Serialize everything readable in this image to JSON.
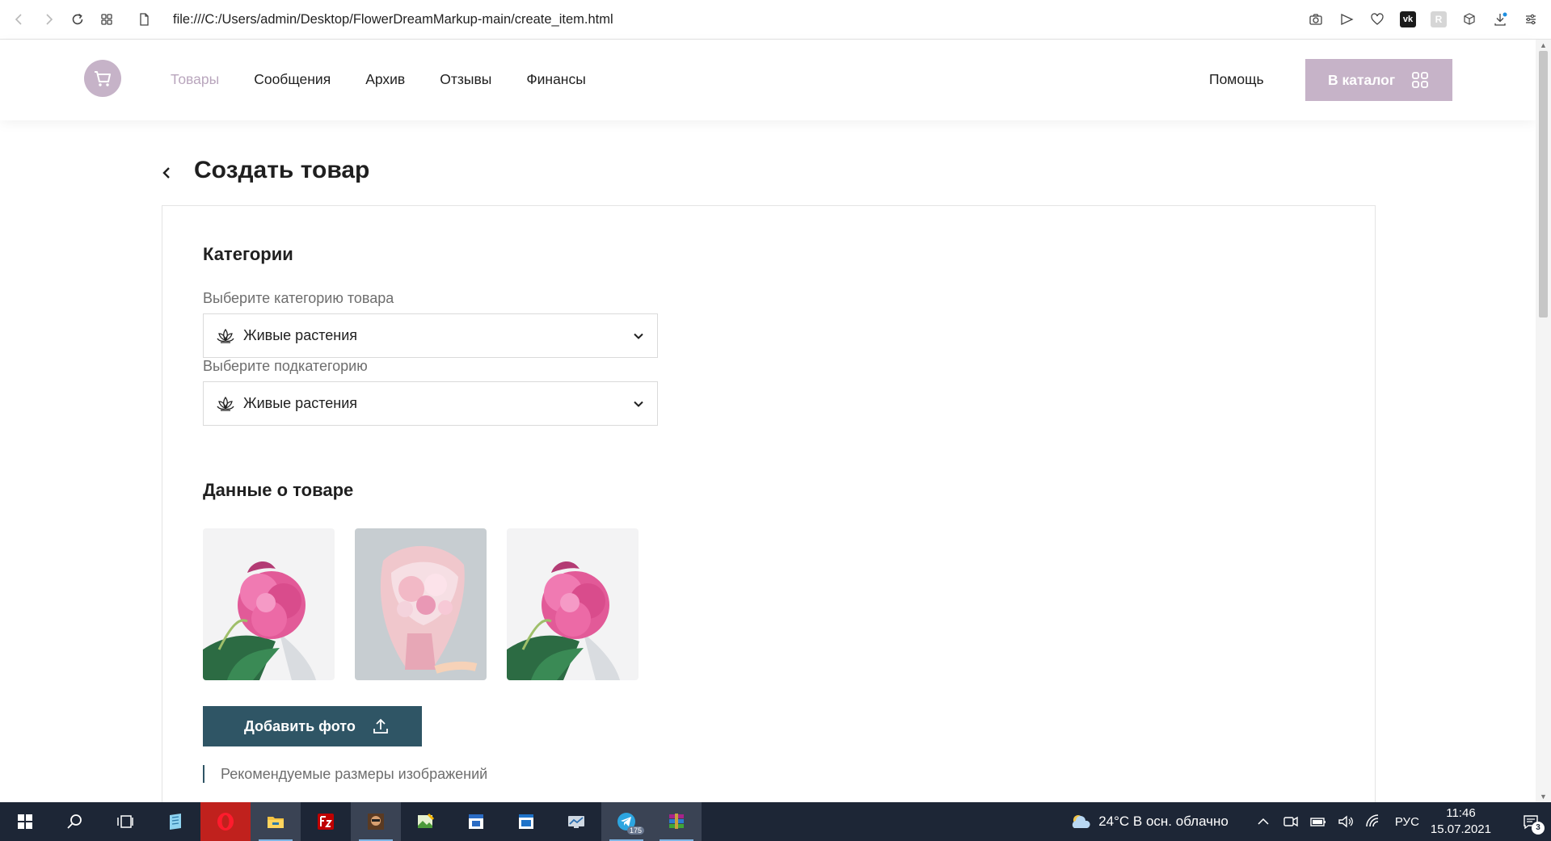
{
  "browser": {
    "url": "file:///C:/Users/admin/Desktop/FlowerDreamMarkup-main/create_item.html",
    "extension_vk": "vk",
    "extension_r": "R"
  },
  "header": {
    "nav": [
      "Товары",
      "Сообщения",
      "Архив",
      "Отзывы",
      "Финансы"
    ],
    "active_nav": "Товары",
    "help": "Помощь",
    "catalog_button": "В каталог",
    "accent_color": "#c6b3c8"
  },
  "page": {
    "title": "Создать товар"
  },
  "form": {
    "categories_title": "Категории",
    "category_label": "Выберите категорию товара",
    "category_value": "Живые растения",
    "subcategory_label": "Выберите подкатегорию",
    "subcategory_value": "Живые растения",
    "product_data_title": "Данные о товаре",
    "photos": [
      "peony-photo",
      "bouquet-photo",
      "peony-photo"
    ],
    "add_photo_button": "Добавить фото",
    "hint": "Рекомендуемые размеры изображений",
    "button_color": "#2f5565"
  },
  "taskbar": {
    "weather": "24°C  В осн. облачно",
    "language": "РУС",
    "time": "11:46",
    "date": "15.07.2021",
    "telegram_badge": "175",
    "notifications": "3"
  }
}
